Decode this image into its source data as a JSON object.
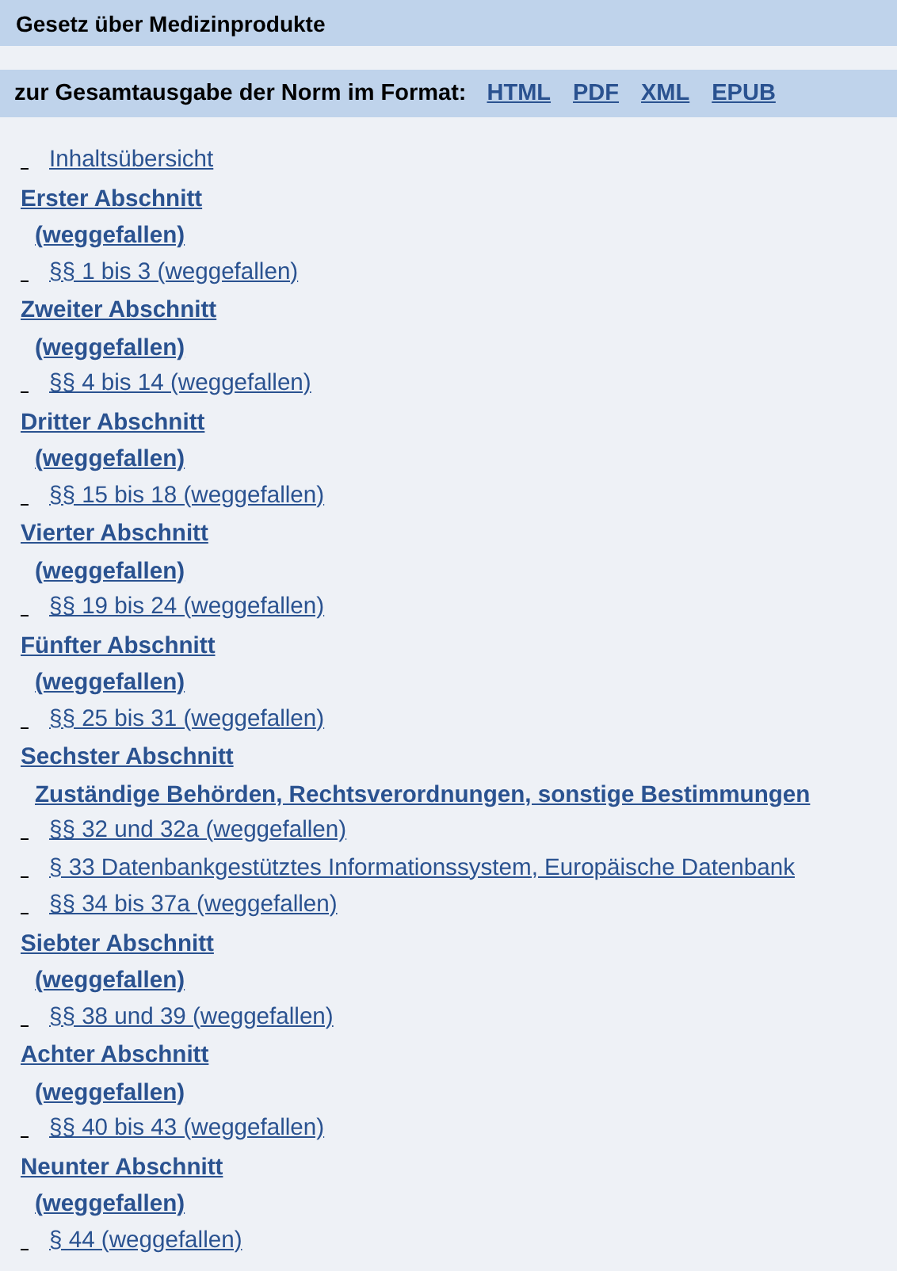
{
  "title": "Gesetz über Medizinprodukte",
  "format_bar": {
    "label": "zur Gesamtausgabe der Norm im Format:",
    "links": [
      "HTML",
      "PDF",
      "XML",
      "EPUB"
    ]
  },
  "toc": [
    {
      "kind": "entry",
      "text": "Inhaltsübersicht"
    },
    {
      "kind": "section",
      "heading": "Erster Abschnitt",
      "subtitle": "(weggefallen)",
      "children": [
        "§§ 1 bis 3 (weggefallen)"
      ]
    },
    {
      "kind": "section",
      "heading": "Zweiter Abschnitt",
      "subtitle": "(weggefallen)",
      "children": [
        "§§ 4 bis 14 (weggefallen)"
      ]
    },
    {
      "kind": "section",
      "heading": "Dritter Abschnitt",
      "subtitle": "(weggefallen)",
      "children": [
        "§§ 15 bis 18 (weggefallen)"
      ]
    },
    {
      "kind": "section",
      "heading": "Vierter Abschnitt",
      "subtitle": "(weggefallen)",
      "children": [
        "§§ 19 bis 24 (weggefallen)"
      ]
    },
    {
      "kind": "section",
      "heading": "Fünfter Abschnitt",
      "subtitle": "(weggefallen)",
      "children": [
        "§§ 25 bis 31 (weggefallen)"
      ]
    },
    {
      "kind": "section",
      "heading": "Sechster Abschnitt",
      "subtitle": "Zuständige Behörden, Rechtsverordnungen, sonstige Bestimmungen",
      "children": [
        "§§ 32 und 32a (weggefallen)",
        "§ 33 Datenbankgestütztes Informationssystem, Europäische Datenbank",
        "§§ 34 bis 37a (weggefallen)"
      ]
    },
    {
      "kind": "section",
      "heading": "Siebter Abschnitt",
      "subtitle": "(weggefallen)",
      "children": [
        "§§ 38 und 39 (weggefallen)"
      ]
    },
    {
      "kind": "section",
      "heading": "Achter Abschnitt",
      "subtitle": "(weggefallen)",
      "children": [
        "§§ 40 bis 43 (weggefallen)"
      ]
    },
    {
      "kind": "section",
      "heading": "Neunter Abschnitt",
      "subtitle": "(weggefallen)",
      "children": [
        "§ 44 (weggefallen)"
      ]
    }
  ]
}
